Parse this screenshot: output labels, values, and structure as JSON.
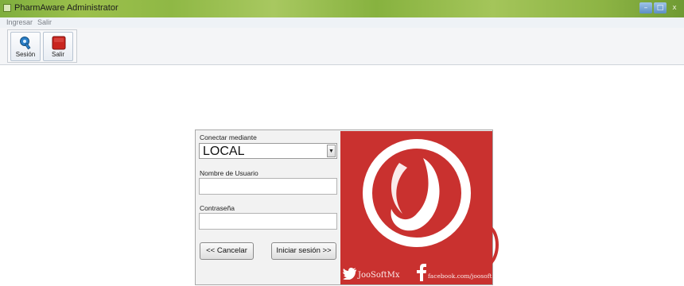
{
  "window": {
    "title": "PharmAware Administrator",
    "min_glyph": "–",
    "max_glyph": "□",
    "close_glyph": "x"
  },
  "menu": {
    "items": [
      "Ingresar",
      "Salir"
    ]
  },
  "toolbar": {
    "session_label": "Sesión",
    "exit_label": "Salir"
  },
  "login": {
    "connect_label": "Conectar mediante",
    "connect_value": "LOCAL",
    "username_label": "Nombre de Usuario",
    "username_value": "",
    "password_label": "Contraseña",
    "password_value": "",
    "cancel_label": "<< Cancelar",
    "login_label": "Iniciar sesión >>"
  },
  "brand": {
    "twitter_handle": "JooSoftMx",
    "facebook_url": "facebook.com/joosoft",
    "color": "#c9312f"
  }
}
